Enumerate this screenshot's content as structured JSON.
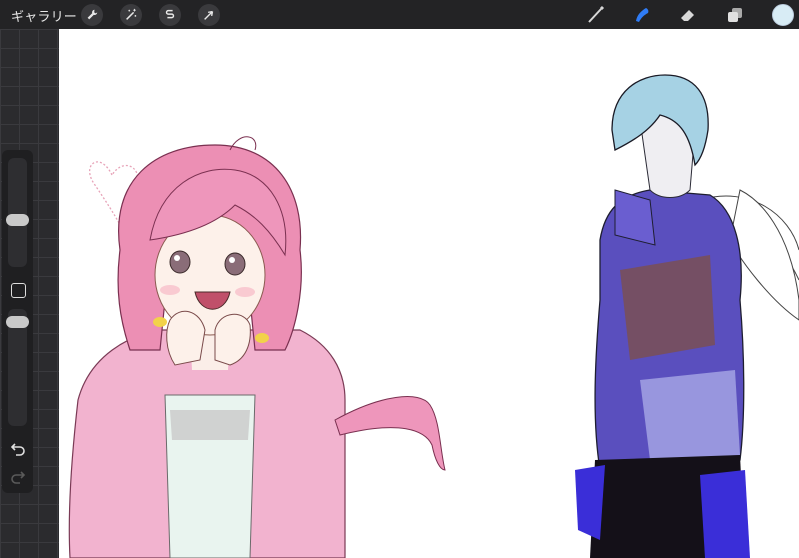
{
  "topbar": {
    "gallery_label": "ギャラリー",
    "actions": [
      {
        "name": "actions",
        "icon": "wrench-icon"
      },
      {
        "name": "adjustments",
        "icon": "magic-wand-icon"
      },
      {
        "name": "selection",
        "icon": "selection-s-icon"
      },
      {
        "name": "transform",
        "icon": "arrow-cursor-icon"
      }
    ],
    "tools": [
      {
        "name": "brush",
        "icon": "brush-icon",
        "active": false
      },
      {
        "name": "smudge",
        "icon": "smudge-finger-icon",
        "active": true
      },
      {
        "name": "eraser",
        "icon": "eraser-icon",
        "active": false
      },
      {
        "name": "layers",
        "icon": "layers-icon",
        "active": false
      }
    ],
    "current_color": "#d8ecf5",
    "active_tool_color": "#2f7cf6"
  },
  "sidebar": {
    "brush_size_level": 0.4,
    "opacity_level": 0.15
  }
}
